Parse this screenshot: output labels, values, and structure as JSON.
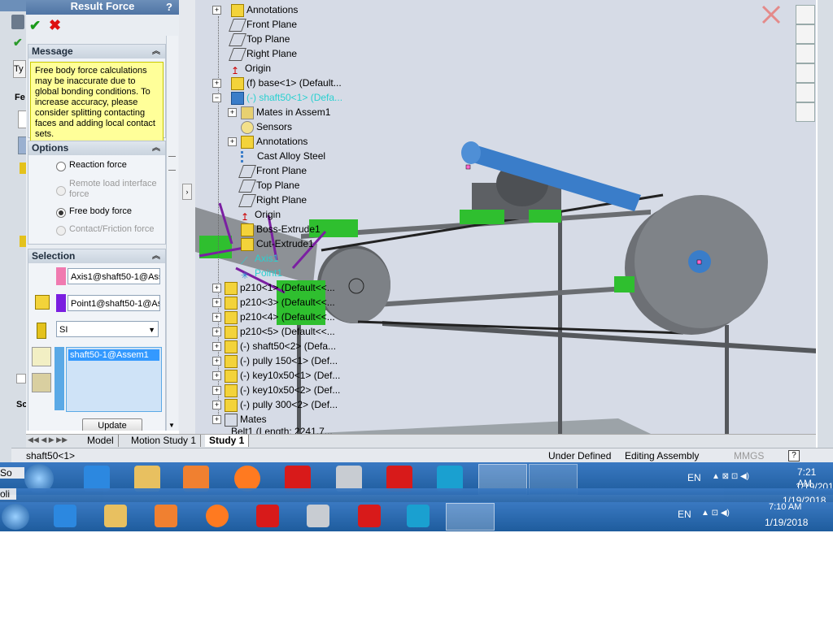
{
  "property_manager": {
    "title": "Result Force",
    "help": "?",
    "message_group": {
      "header": "Message",
      "text": "Free body force calculations may be inaccurate due to global bonding conditions.  To increase accuracy, please consider splitting contacting faces and adding local contact sets."
    },
    "options_group": {
      "header": "Options",
      "reaction_force": "Reaction force",
      "remote_load": "Remote load interface force",
      "free_body_force": "Free body force",
      "contact_friction": "Contact/Friction force"
    },
    "selection_group": {
      "header": "Selection",
      "axis_value": "Axis1@shaft50-1@Ass",
      "point_value": "Point1@shaft50-1@As",
      "units_value": "SI",
      "component_value": "shaft50-1@Assem1",
      "update_label": "Update"
    },
    "partial_labels": {
      "ty": "Ty",
      "fe": "Fe",
      "sc": "Sc"
    }
  },
  "tree": {
    "items": [
      {
        "label": "Annotations",
        "icon": "annotations-icon"
      },
      {
        "label": "Front Plane",
        "icon": "plane-icon"
      },
      {
        "label": "Top Plane",
        "icon": "plane-icon"
      },
      {
        "label": "Right Plane",
        "icon": "plane-icon"
      },
      {
        "label": "Origin",
        "icon": "origin-icon"
      },
      {
        "label": "(f) base<1> (Default...",
        "icon": "part-icon"
      },
      {
        "label": "(-) shaft50<1> (Defa...",
        "icon": "part-icon"
      },
      {
        "label": "Mates in Assem1",
        "icon": "mates-icon"
      },
      {
        "label": "Sensors",
        "icon": "sensor-icon"
      },
      {
        "label": "Annotations",
        "icon": "annotations-icon"
      },
      {
        "label": "Cast Alloy Steel",
        "icon": "material-icon"
      },
      {
        "label": "Front Plane",
        "icon": "plane-icon"
      },
      {
        "label": "Top Plane",
        "icon": "plane-icon"
      },
      {
        "label": "Right Plane",
        "icon": "plane-icon"
      },
      {
        "label": "Origin",
        "icon": "origin-icon"
      },
      {
        "label": "Boss-Extrude1",
        "icon": "feature-icon"
      },
      {
        "label": "Cut-Extrude1",
        "icon": "feature-icon"
      },
      {
        "label": "Axis1",
        "icon": "axis-icon"
      },
      {
        "label": "Point1",
        "icon": "point-icon"
      },
      {
        "label": "p210<1> (Default<<...",
        "icon": "part-icon"
      },
      {
        "label": "p210<3> (Default<<...",
        "icon": "part-icon"
      },
      {
        "label": "p210<4> (Default<<...",
        "icon": "part-icon"
      },
      {
        "label": "p210<5> (Default<<...",
        "icon": "part-icon"
      },
      {
        "label": "(-) shaft50<2> (Defa...",
        "icon": "part-icon"
      },
      {
        "label": "(-) pully 150<1> (Def...",
        "icon": "part-icon"
      },
      {
        "label": "(-) key10x50<1> (Def...",
        "icon": "part-icon"
      },
      {
        "label": "(-) key10x50<2> (Def...",
        "icon": "part-icon"
      },
      {
        "label": "(-) pully 300<2> (Def...",
        "icon": "part-icon"
      },
      {
        "label": "Mates",
        "icon": "mates-icon"
      },
      {
        "label": "Belt1 (Length: 2241.7...",
        "icon": "belt-icon"
      }
    ]
  },
  "tabs": {
    "model": "Model",
    "motion1": "Motion Study 1",
    "study1": "Study 1"
  },
  "status": {
    "selection": "shaft50<1>",
    "state": "Under Defined",
    "mode": "Editing Assembly",
    "units": "MMGS",
    "help": "?"
  },
  "taskbar": {
    "lang": "EN",
    "time": "7:21 AM",
    "date": "1/19/201",
    "lang2": "EN",
    "time2": "7:10 AM",
    "date2": "1/19/2018",
    "date3": "1/19/2018",
    "partial_so": "So",
    "partial_oli": "oli"
  },
  "colors": {
    "title_bar": "#4f74a4",
    "message_bg": "#ffff99",
    "shaft_blue": "#3a7dc9",
    "taskbar": "#1e5c9d",
    "selection_highlight": "#3399ff"
  }
}
